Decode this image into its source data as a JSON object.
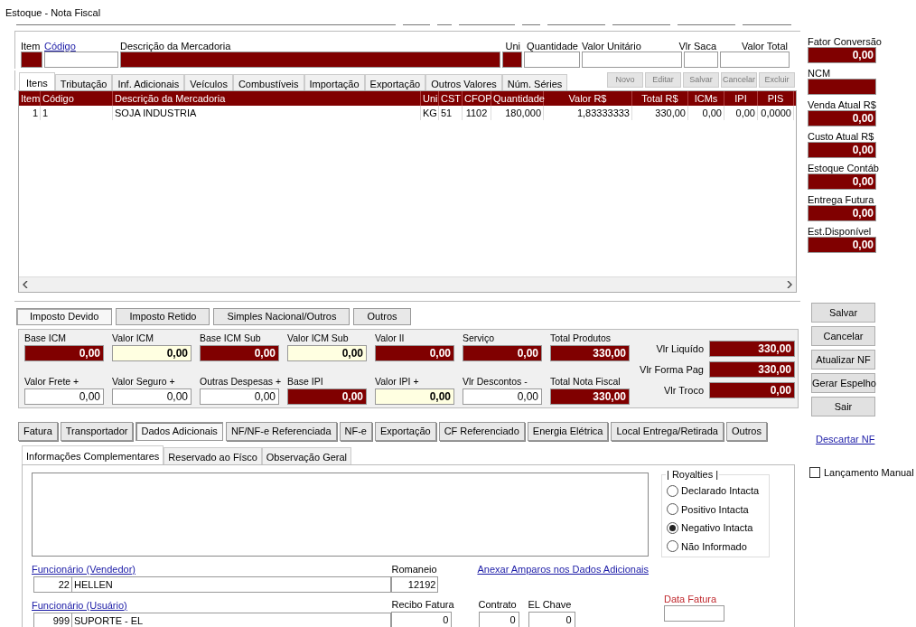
{
  "window": {
    "title": "Estoque - Nota Fiscal"
  },
  "entry_fields": [
    {
      "label": "Item",
      "kind": "locked",
      "link": false
    },
    {
      "label": "Código",
      "kind": "input",
      "link": true
    },
    {
      "label": "Descrição da Mercadoria",
      "kind": "locked",
      "link": false
    },
    {
      "label": "Uni",
      "kind": "locked",
      "link": false
    },
    {
      "label": "Quantidade",
      "kind": "input",
      "link": false
    },
    {
      "label": "Valor Unitário",
      "kind": "input",
      "link": false
    },
    {
      "label": "Vlr Saca",
      "kind": "input",
      "link": false
    },
    {
      "label": "Valor Total",
      "kind": "input",
      "link": false
    }
  ],
  "item_tabs": [
    {
      "label": "Itens",
      "selected": true
    },
    {
      "label": "Tributação",
      "selected": false
    },
    {
      "label": "Inf. Adicionais",
      "selected": false
    },
    {
      "label": "Veículos",
      "selected": false
    },
    {
      "label": "Combustíveis",
      "selected": false
    },
    {
      "label": "Importação",
      "selected": false
    },
    {
      "label": "Exportação",
      "selected": false
    },
    {
      "label": "Outros Valores",
      "selected": false
    },
    {
      "label": "Núm. Séries",
      "selected": false
    }
  ],
  "grid_buttons": [
    {
      "label": "Novo",
      "disabled": true
    },
    {
      "label": "Editar",
      "disabled": true
    },
    {
      "label": "Salvar",
      "disabled": true
    },
    {
      "label": "Cancelar",
      "disabled": true
    },
    {
      "label": "Excluir",
      "disabled": true
    }
  ],
  "grid": {
    "columns": [
      "Item",
      "Código",
      "Descrição da Mercadoria",
      "Uni",
      "CST",
      "CFOP",
      "Quantidade",
      "Valor R$",
      "Total R$",
      "ICMs",
      "IPI",
      "PIS"
    ],
    "rows": [
      [
        "1",
        "1",
        "SOJA INDUSTRIA",
        "KG",
        "51",
        "1102",
        "180,000",
        "1,83333333",
        "330,00",
        "0,00",
        "0,00",
        "0,0000"
      ]
    ]
  },
  "side_fields": [
    {
      "label": "Fator Conversão",
      "value": "0,00"
    },
    {
      "label": "NCM"
    },
    {
      "label": "Venda Atual R$",
      "value": "0,00"
    },
    {
      "label": "Custo Atual R$",
      "value": "0,00"
    },
    {
      "label": "Estoque Contáb",
      "value": "0,00"
    },
    {
      "label": "Entrega Futura",
      "value": "0,00"
    },
    {
      "label": "Est.Disponível",
      "value": "0,00"
    }
  ],
  "tax_tabs": [
    {
      "label": "Imposto Devido",
      "selected": true
    },
    {
      "label": "Imposto Retido",
      "selected": false
    },
    {
      "label": "Simples Nacional/Outros",
      "selected": false
    },
    {
      "label": "Outros",
      "selected": false
    }
  ],
  "totals": [
    {
      "label": "Base ICM",
      "value": "0,00",
      "kind": "locked"
    },
    {
      "label": "Valor ICM",
      "value": "0,00",
      "kind": "highlight"
    },
    {
      "label": "Base ICM Sub",
      "value": "0,00",
      "kind": "locked"
    },
    {
      "label": "Valor ICM Sub",
      "value": "0,00",
      "kind": "highlight"
    },
    {
      "label": "Valor II",
      "value": "0,00",
      "kind": "locked"
    },
    {
      "label": "Serviço",
      "value": "0,00",
      "kind": "locked"
    },
    {
      "label": "Total Produtos",
      "value": "330,00",
      "kind": "locked"
    },
    {
      "label": "Valor Frete +",
      "value": "0,00",
      "kind": "input"
    },
    {
      "label": "Valor Seguro +",
      "value": "0,00",
      "kind": "input"
    },
    {
      "label": "Outras Despesas +",
      "value": "0,00",
      "kind": "input"
    },
    {
      "label": "Base IPI",
      "value": "0,00",
      "kind": "locked"
    },
    {
      "label": "Valor IPI +",
      "value": "0,00",
      "kind": "highlight"
    },
    {
      "label": "Vlr Descontos -",
      "value": "0,00",
      "kind": "input"
    },
    {
      "label": "Total Nota Fiscal",
      "value": "330,00",
      "kind": "locked"
    }
  ],
  "summary": [
    {
      "label": "Vlr Liquído",
      "value": "330,00"
    },
    {
      "label": "Vlr Forma Pag",
      "value": "330,00"
    },
    {
      "label": "Vlr Troco",
      "value": "0,00"
    }
  ],
  "actions": [
    "Salvar",
    "Cancelar",
    "Atualizar NF",
    "Gerar Espelho",
    "Sair"
  ],
  "discard_link": "Descartar NF",
  "manual_entry": {
    "label": "Lançamento Manual",
    "checked": false
  },
  "section_tabs": [
    {
      "label": "Fatura",
      "selected": false
    },
    {
      "label": "Transportador",
      "selected": false
    },
    {
      "label": "Dados Adicionais",
      "selected": true
    },
    {
      "label": "NF/NF-e Referenciada",
      "selected": false
    },
    {
      "label": "NF-e",
      "selected": false
    },
    {
      "label": "Exportação",
      "selected": false
    },
    {
      "label": "CF Referenciado",
      "selected": false
    },
    {
      "label": "Energia Elétrica",
      "selected": false
    },
    {
      "label": "Local Entrega/Retirada",
      "selected": false
    },
    {
      "label": "Outros",
      "selected": false
    }
  ],
  "sub_tabs": [
    {
      "label": "Informações Complementares",
      "selected": true
    },
    {
      "label": "Reservado ao Físco",
      "selected": false
    },
    {
      "label": "Observação Geral",
      "selected": false
    }
  ],
  "royalties": {
    "title": "| Royalties |",
    "options": [
      {
        "label": "Declarado Intacta",
        "selected": false
      },
      {
        "label": "Positivo Intacta",
        "selected": false
      },
      {
        "label": "Negativo Intacta",
        "selected": true
      },
      {
        "label": "Não Informado",
        "selected": false
      }
    ]
  },
  "employees": [
    {
      "label": "Funcionário (Vendedor)",
      "code": "22",
      "name": "HELLEN"
    },
    {
      "label": "Funcionário (Usuário)",
      "code": "999",
      "name": "SUPORTE - EL"
    }
  ],
  "romaneio": {
    "label": "Romaneio",
    "value": "12192"
  },
  "attach_link": "Anexar Amparos nos Dados Adicionais",
  "invoice_fields": [
    {
      "label": "Recibo Fatura",
      "value": "0"
    },
    {
      "label": "Contrato",
      "value": "0"
    },
    {
      "label": "EL Chave",
      "value": "0"
    }
  ],
  "invoice_date": {
    "label": "Data Fatura"
  }
}
